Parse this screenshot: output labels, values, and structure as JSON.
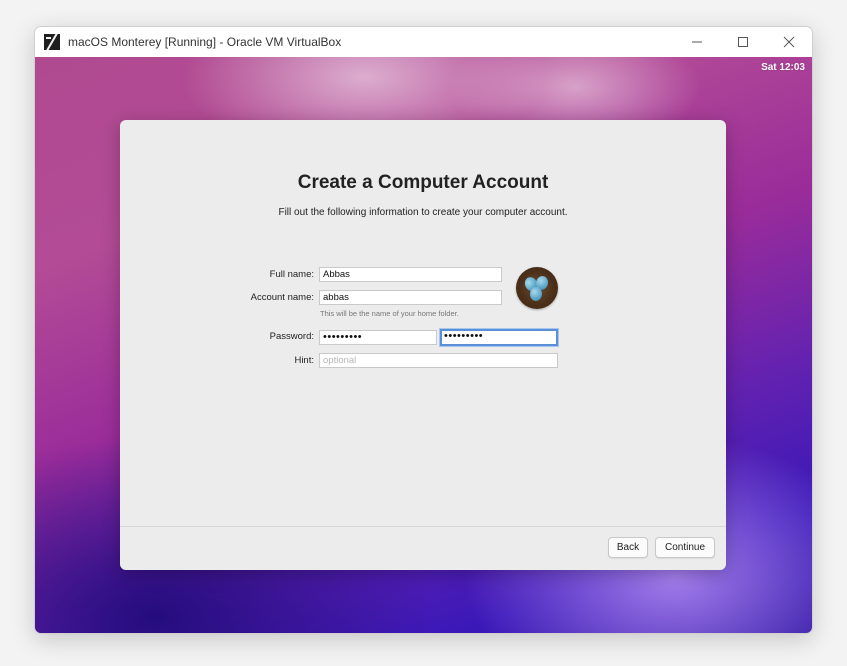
{
  "window": {
    "title": "macOS Monterey [Running] - Oracle VM VirtualBox",
    "controls": {
      "minimize": "—",
      "maximize": "☐",
      "close": "✕"
    }
  },
  "menubar": {
    "clock": "Sat 12:03"
  },
  "setup": {
    "title": "Create a Computer Account",
    "subtitle": "Fill out the following information to create your computer account.",
    "full_name": {
      "label": "Full name:",
      "value": "Abbas"
    },
    "account_name": {
      "label": "Account name:",
      "value": "abbas",
      "helper": "This will be the name of your home folder."
    },
    "password": {
      "label": "Password:",
      "value": "•••••••••",
      "verify_value": "•••••••••"
    },
    "hint": {
      "label": "Hint:",
      "placeholder": "optional"
    },
    "buttons": {
      "back": "Back",
      "continue": "Continue"
    }
  },
  "colors": {
    "focus_ring": "#5b8fd8",
    "dialog_bg": "#ececec",
    "desktop_primary": "#6422b0"
  }
}
